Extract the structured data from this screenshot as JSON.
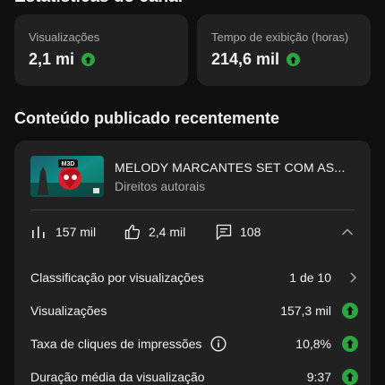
{
  "page": {
    "section_title_top": "Estatísticas do canal",
    "stats": [
      {
        "label": "Visualizações",
        "value": "2,1 mi",
        "trend": "up"
      },
      {
        "label": "Tempo de exibição (horas)",
        "value": "214,6 mil",
        "trend": "up"
      }
    ],
    "recent_title": "Conteúdo publicado recentemente"
  },
  "video": {
    "thumbnail_icon": "video-thumbnail",
    "title": "MELODY MARCANTES SET COM AS...",
    "subtitle": "Direitos autorais",
    "views": "157 mil",
    "likes": "2,4 mil",
    "comments": "108"
  },
  "details": [
    {
      "label": "Classificação por visualizações",
      "value": "1 de 10",
      "trail": "chevron"
    },
    {
      "label": "Visualizações",
      "value": "157,3 mil",
      "trail": "up"
    },
    {
      "label": "Taxa de cliques de impressões",
      "value": "10,8%",
      "trail": "up",
      "info": true
    },
    {
      "label": "Duração média da visualização",
      "value": "9:37",
      "trail": "up"
    }
  ],
  "colors": {
    "background": "#0f0f0f",
    "card": "#212121",
    "trend_up": "#2ba640",
    "muted_text": "#aaaaaa"
  }
}
